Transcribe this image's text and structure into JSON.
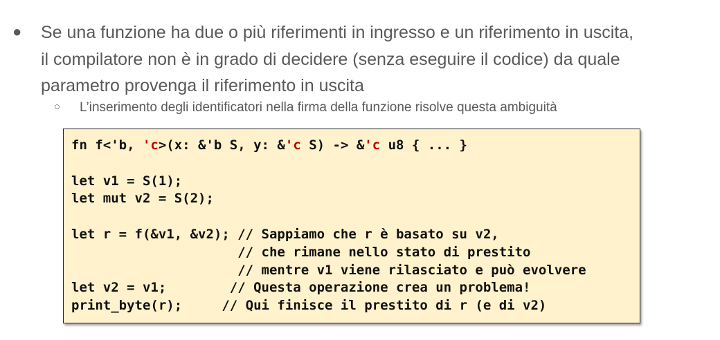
{
  "slide": {
    "bullet_symbol": "●",
    "main_lines": [
      "Se una funzione ha due o più riferimenti in ingresso e un riferimento in uscita,",
      "il compilatore non è in grado di decidere (senza eseguire il codice) da quale",
      "parametro provenga il riferimento in uscita"
    ],
    "sub_bullet_symbol": "○",
    "sub_text": "L’inserimento degli identificatori nella firma della funzione risolve questa ambiguità"
  },
  "code": {
    "line1": {
      "a": "fn f<'b, ",
      "b": "'c",
      "c": ">(x: &'b S, y: &",
      "d": "'c",
      "e": " S) -> &",
      "f": "'c",
      "g": " u8 { ... }"
    },
    "line3": "let v1 = S(1);",
    "line4": "let mut v2 = S(2);",
    "line6": "let r = f(&v1, &v2); // Sappiamo che r è basato su v2,",
    "line7": "                     // che rimane nello stato di prestito",
    "line8": "                     // mentre v1 viene rilasciato e può evolvere",
    "line9": "let v2 = v1;        // Questa operazione crea un problema!",
    "line10": "print_byte(r);     // Qui finisce il prestito di r (e di v2)",
    "highlight_color": "#c00000",
    "background_color": "#fff2cc"
  }
}
